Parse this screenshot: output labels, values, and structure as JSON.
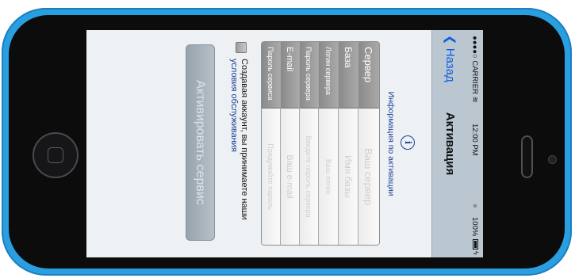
{
  "status_bar": {
    "carrier": "●●●●○ CARRIER ",
    "wifi_icon": "wifi-icon",
    "time": "12:00 PM",
    "bluetooth_icon": "bluetooth-icon",
    "battery": "100%",
    "battery_icon": "battery-full-icon",
    "charging_icon": "charging-bolt-icon"
  },
  "nav": {
    "back_label": "Назад",
    "back_icon": "chevron-left-icon",
    "title": "Активация"
  },
  "info": {
    "icon_glyph": "i",
    "link_text": "Информация по активации"
  },
  "form": {
    "rows": [
      {
        "label": "Сервер",
        "placeholder": "Ваш сервер"
      },
      {
        "label": "База",
        "placeholder": "Имя базы"
      },
      {
        "label": "Логин сервера",
        "placeholder": "Ваш логин"
      },
      {
        "label": "Пароль сервера",
        "placeholder": "Введите пароль сервера"
      },
      {
        "label": "E-mail",
        "placeholder": "Ваш e-mail"
      },
      {
        "label": "Пароль сервиса",
        "placeholder": "Придумайте пароль"
      }
    ]
  },
  "terms": {
    "text": "Создавая аккаунт, вы принимаете наши ",
    "link": "условия обслуживания",
    "checked": false
  },
  "activate_button_label": "Активировать сервис",
  "colors": {
    "phone_body": "#2a9fe0",
    "nav_bar": "#bac6d0",
    "link_blue": "#1b3f9a",
    "back_blue": "#0a5fe0",
    "button": "#a5b0ba"
  }
}
